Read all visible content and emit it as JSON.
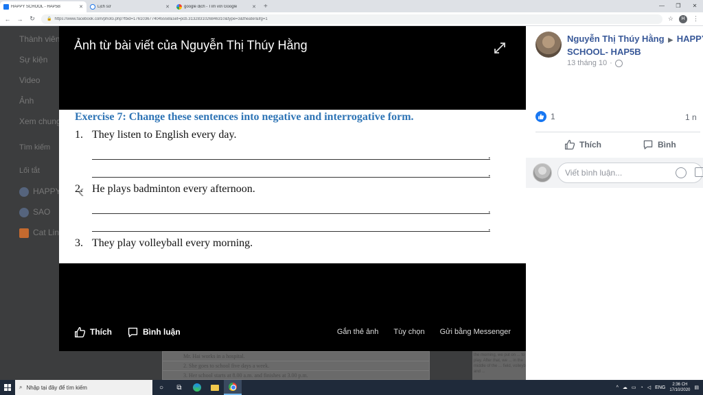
{
  "browser": {
    "tabs": [
      {
        "title": "HAPPY SCHOOL - HAP5B",
        "active": true,
        "favicon": "facebook-icon"
      },
      {
        "title": "Lịch sử",
        "active": false,
        "favicon": "history-icon"
      },
      {
        "title": "google dịch - Tìm với Google",
        "active": false,
        "favicon": "google-icon"
      }
    ],
    "new_tab": "+",
    "url": "https://www.facebook.com/photo.php?fbid=1761036774045558&set=pcb.3132831026846310&type=3&theater&ifg=1",
    "profile_initial": "H"
  },
  "background": {
    "sidebar": [
      "Thành viên",
      "Sự kiện",
      "Video",
      "Ảnh",
      "Xem chung",
      "Tìm kiếm",
      "Lối tắt",
      "HAPPY",
      "SAO",
      "Cat Lin"
    ],
    "doc_rows": [
      {
        "num": "",
        "text": "Mr. Hai works in a hospital."
      },
      {
        "num": "2.",
        "text": "She goes to school five days a week."
      },
      {
        "num": "3.",
        "text": "Her school starts at 8.00 a.m. and finishes at 3.00 p.m."
      }
    ],
    "doc2_text": "the morning, we put on ... to play. After that, we ... in the middle of the ... field, volleyball and ..."
  },
  "viewer": {
    "title": "Ảnh từ bài viết của Nguyễn Thị Thúy Hằng",
    "photo": {
      "exercise_title": "Exercise 7: Change these sentences into negative and interrogative form.",
      "questions": [
        {
          "num": "1.",
          "text": "They listen to English every day."
        },
        {
          "num": "2.",
          "text": "He plays badminton every afternoon."
        },
        {
          "num": "3.",
          "text": "They play volleyball every morning."
        }
      ],
      "line_end": "."
    },
    "actions": {
      "like": "Thích",
      "comment": "Bình luận",
      "tag": "Gắn thẻ ảnh",
      "options": "Tùy chọn",
      "messenger": "Gửi bằng Messenger"
    }
  },
  "post": {
    "author": "Nguyễn Thị Thúy Hằng",
    "group": "HAPPY SCHOOL- HAP5B",
    "date": "13 tháng 10",
    "like_count": "1",
    "share_count": "1 n",
    "like_label": "Thích",
    "comment_label": "Bình",
    "comment_placeholder": "Viết bình luận..."
  },
  "taskbar": {
    "search_placeholder": "Nhập tại đây để tìm kiếm",
    "language": "ENG",
    "time": "2:36 CH",
    "date": "17/10/2020"
  },
  "colors": {
    "fb_blue": "#1877f2",
    "author_blue": "#385898",
    "exercise_blue": "#2e74b5"
  }
}
